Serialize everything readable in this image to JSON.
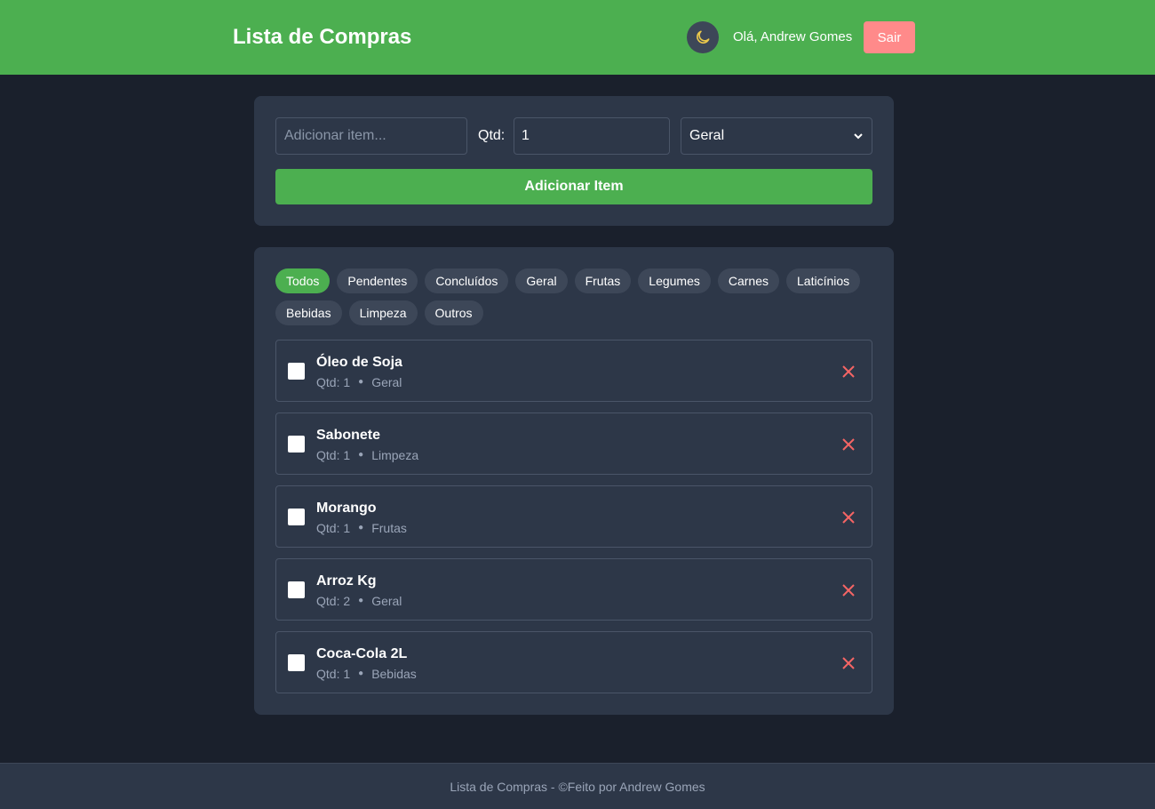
{
  "header": {
    "title": "Lista de Compras",
    "theme_icon": "moon-icon",
    "greeting": "Olá, Andrew Gomes",
    "logout_label": "Sair"
  },
  "add_form": {
    "item_placeholder": "Adicionar item...",
    "qty_label": "Qtd:",
    "qty_value": "1",
    "category_selected": "Geral",
    "add_button_label": "Adicionar Item"
  },
  "filters": [
    {
      "label": "Todos",
      "active": true
    },
    {
      "label": "Pendentes",
      "active": false
    },
    {
      "label": "Concluídos",
      "active": false
    },
    {
      "label": "Geral",
      "active": false
    },
    {
      "label": "Frutas",
      "active": false
    },
    {
      "label": "Legumes",
      "active": false
    },
    {
      "label": "Carnes",
      "active": false
    },
    {
      "label": "Laticínios",
      "active": false
    },
    {
      "label": "Bebidas",
      "active": false
    },
    {
      "label": "Limpeza",
      "active": false
    },
    {
      "label": "Outros",
      "active": false
    }
  ],
  "items": [
    {
      "name": "Óleo de Soja",
      "qty": "Qtd: 1",
      "category": "Geral",
      "checked": false
    },
    {
      "name": "Sabonete",
      "qty": "Qtd: 1",
      "category": "Limpeza",
      "checked": false
    },
    {
      "name": "Morango",
      "qty": "Qtd: 1",
      "category": "Frutas",
      "checked": false
    },
    {
      "name": "Arroz Kg",
      "qty": "Qtd: 2",
      "category": "Geral",
      "checked": false
    },
    {
      "name": "Coca-Cola 2L",
      "qty": "Qtd: 1",
      "category": "Bebidas",
      "checked": false
    }
  ],
  "footer": {
    "text": "Lista de Compras - ©Feito por Andrew Gomes"
  },
  "colors": {
    "brand_green": "#4caf50",
    "background": "#1a202c",
    "card": "#2d3748",
    "logout_red": "#ff8a8a",
    "delete_red": "#f56565",
    "moon_yellow": "#ecc94b"
  }
}
